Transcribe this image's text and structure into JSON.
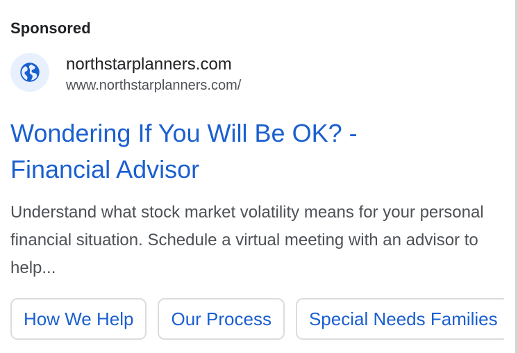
{
  "ad": {
    "sponsored_label": "Sponsored",
    "site_name": "northstarplanners.com",
    "site_url": "www.northstarplanners.com/",
    "favicon_icon": "globe-icon",
    "headline_line1": "Wondering If You Will Be OK? -",
    "headline_line2": "Financial Advisor",
    "description": "Understand what stock market volatility means for your personal financial situation. Schedule a virtual meeting with an advisor to help...",
    "sitelinks": [
      {
        "label": "How We Help"
      },
      {
        "label": "Our Process"
      },
      {
        "label": "Special Needs Families"
      }
    ]
  },
  "colors": {
    "link_blue": "#1a5fd0",
    "favicon_bg": "#e8f0fe",
    "favicon_fg": "#1a5fd0",
    "text_primary": "#202124",
    "text_secondary": "#4d5156",
    "chip_border": "#dadce0"
  }
}
